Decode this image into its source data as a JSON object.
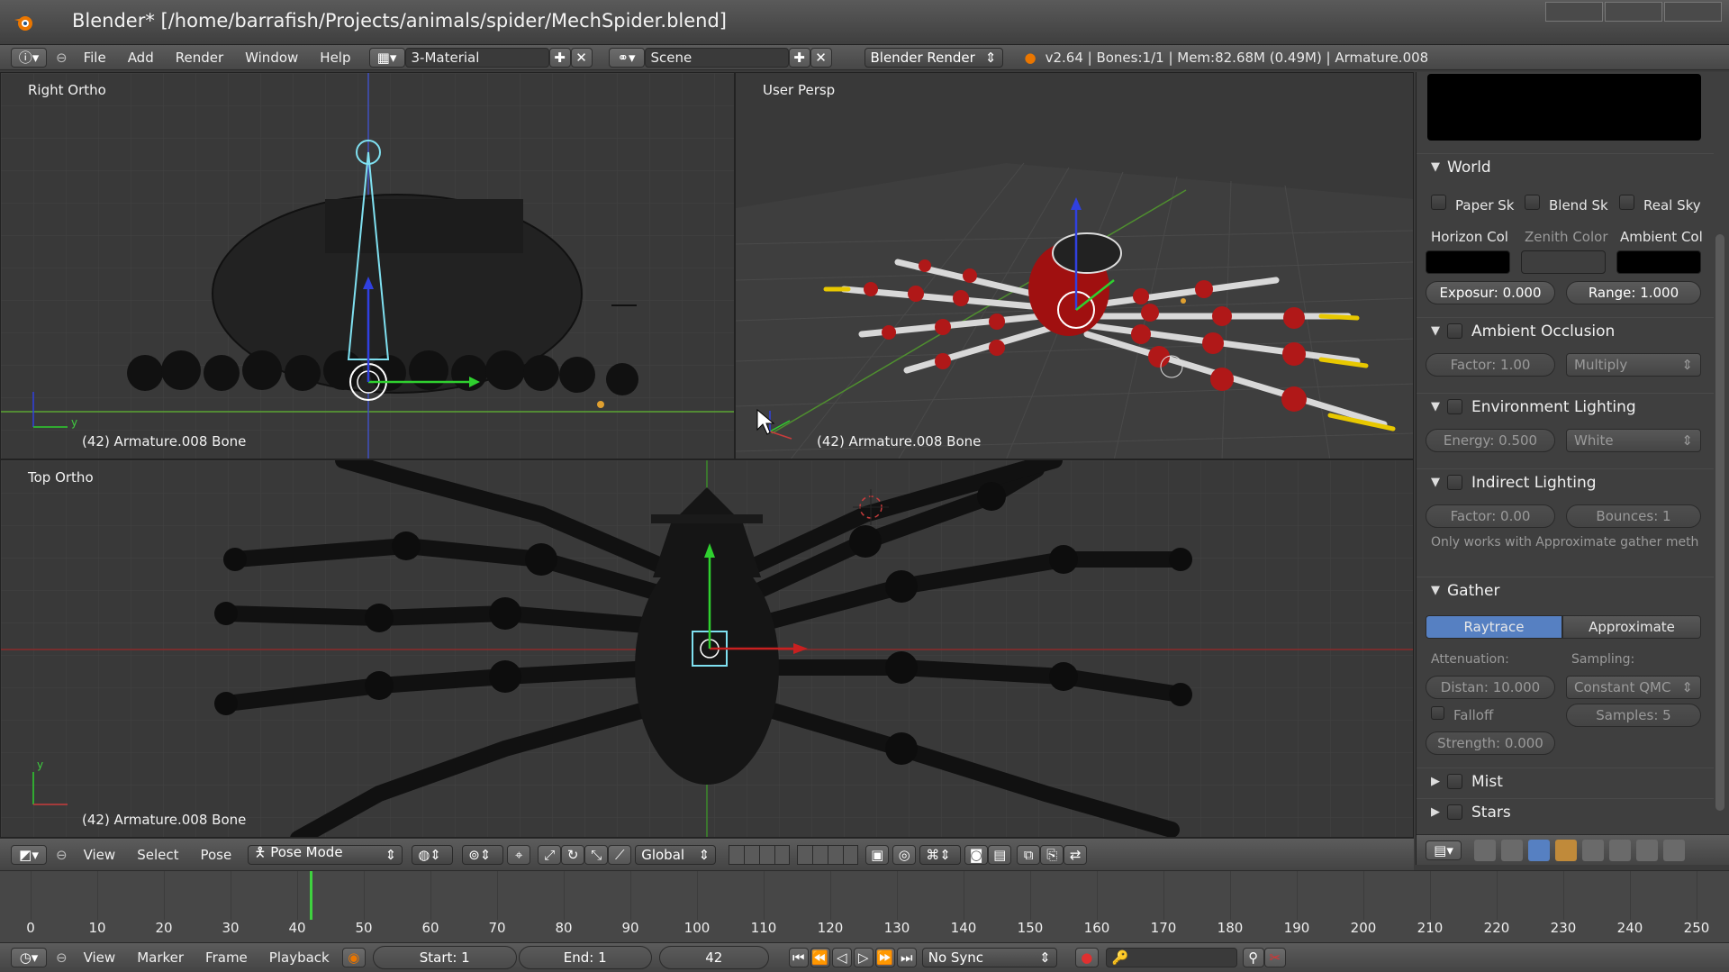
{
  "window": {
    "title": "Blender* [/home/barrafish/Projects/animals/spider/MechSpider.blend]"
  },
  "info_header": {
    "menus": [
      "File",
      "Add",
      "Render",
      "Window",
      "Help"
    ],
    "screen_layout": "3-Material",
    "scene": "Scene",
    "render_engine": "Blender Render",
    "stats": "v2.64 | Bones:1/1 | Mem:82.68M (0.49M) | Armature.008"
  },
  "viewports": {
    "right_ortho": {
      "label": "Right Ortho",
      "object": "(42) Armature.008 Bone"
    },
    "user_persp": {
      "label": "User Persp",
      "object": "(42) Armature.008 Bone"
    },
    "top_ortho": {
      "label": "Top Ortho",
      "object": "(42) Armature.008 Bone"
    }
  },
  "view3d_header": {
    "menus": [
      "View",
      "Select",
      "Pose"
    ],
    "mode": "Pose Mode",
    "orientation": "Global"
  },
  "properties": {
    "world": {
      "title": "World",
      "paper_sky": "Paper Sk",
      "blend_sky": "Blend Sk",
      "real_sky": "Real Sky",
      "horizon_color_label": "Horizon Col",
      "zenith_color_label": "Zenith Color",
      "ambient_color_label": "Ambient Col",
      "exposure": "Exposur: 0.000",
      "range": "Range: 1.000"
    },
    "ambient_occlusion": {
      "title": "Ambient Occlusion",
      "factor": "Factor: 1.00",
      "blend_mode": "Multiply"
    },
    "environment_lighting": {
      "title": "Environment Lighting",
      "energy": "Energy: 0.500",
      "color": "White"
    },
    "indirect_lighting": {
      "title": "Indirect Lighting",
      "factor": "Factor: 0.00",
      "bounces": "Bounces: 1",
      "note": "Only works with Approximate gather meth"
    },
    "gather": {
      "title": "Gather",
      "tabs": [
        "Raytrace",
        "Approximate"
      ],
      "active_tab": "Raytrace",
      "attenuation_label": "Attenuation:",
      "sampling_label": "Sampling:",
      "distance": "Distan: 10.000",
      "sampling_method": "Constant QMC",
      "falloff": "Falloff",
      "samples": "Samples: 5",
      "strength": "Strength: 0.000"
    },
    "mist": {
      "title": "Mist"
    },
    "stars": {
      "title": "Stars"
    }
  },
  "timeline": {
    "ticks": [
      "0",
      "10",
      "20",
      "30",
      "40",
      "50",
      "60",
      "70",
      "80",
      "90",
      "100",
      "110",
      "120",
      "130",
      "140",
      "150",
      "160",
      "170",
      "180",
      "190",
      "200",
      "210",
      "220",
      "230",
      "240",
      "250"
    ],
    "current_frame": 42,
    "menus": [
      "View",
      "Marker",
      "Frame",
      "Playback"
    ],
    "start": "Start: 1",
    "end": "End: 1",
    "frame": "42",
    "sync": "No Sync"
  },
  "colors": {
    "accent_blue": "#5680c2",
    "x_axis": "#c83c3c",
    "y_axis": "#5aa532",
    "bone_cyan": "#7fe0f0",
    "current_frame": "#3fd23f"
  }
}
